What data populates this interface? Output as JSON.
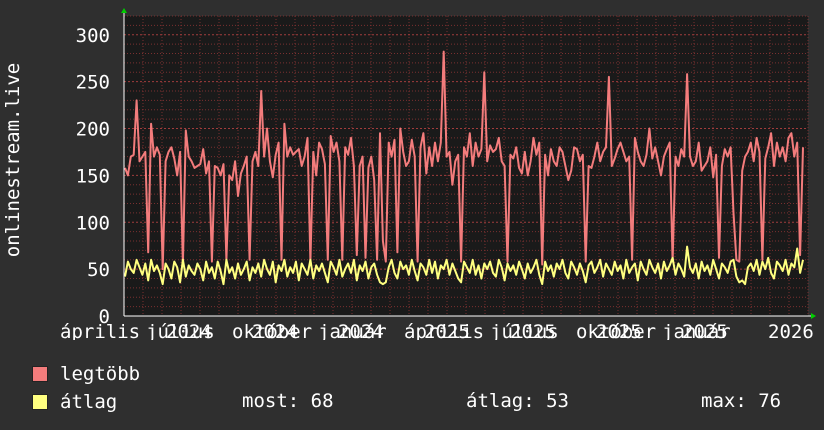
{
  "chart_data": {
    "type": "line",
    "ylabel": "onlinestream.live",
    "ylim": [
      0,
      320
    ],
    "yticks": [
      0,
      50,
      100,
      150,
      200,
      250,
      300
    ],
    "xticks": [
      {
        "label": "április",
        "t": 0.0
      },
      {
        "label": "2024",
        "t": 0.0
      },
      {
        "label": "július",
        "t": 0.125
      },
      {
        "label": "2024",
        "t": 0.125
      },
      {
        "label": "október",
        "t": 0.25
      },
      {
        "label": "2024",
        "t": 0.25
      },
      {
        "label": "január",
        "t": 0.375
      },
      {
        "label": "2025",
        "t": 0.375
      },
      {
        "label": "április",
        "t": 0.5
      },
      {
        "label": "2025",
        "t": 0.5
      },
      {
        "label": "július",
        "t": 0.625
      },
      {
        "label": "2025",
        "t": 0.625
      },
      {
        "label": "október",
        "t": 0.75
      },
      {
        "label": "2025",
        "t": 0.75
      },
      {
        "label": "január",
        "t": 0.875
      },
      {
        "label": "2026",
        "t": 0.875
      }
    ],
    "grid": true,
    "series": [
      {
        "name": "legtöbb",
        "color": "#f37c7c",
        "values": [
          158,
          150,
          170,
          172,
          230,
          165,
          170,
          175,
          68,
          205,
          170,
          180,
          172,
          50,
          165,
          175,
          180,
          168,
          150,
          175,
          55,
          198,
          170,
          165,
          158,
          160,
          162,
          178,
          152,
          165,
          58,
          160,
          158,
          150,
          162,
          60,
          150,
          145,
          165,
          128,
          152,
          160,
          170,
          60,
          165,
          175,
          160,
          240,
          170,
          200,
          165,
          148,
          172,
          185,
          60,
          205,
          170,
          180,
          172,
          175,
          178,
          160,
          170,
          190,
          58,
          175,
          150,
          185,
          178,
          162,
          60,
          192,
          175,
          185,
          165,
          60,
          180,
          172,
          190,
          160,
          65,
          160,
          170,
          62,
          158,
          170,
          145,
          60,
          195,
          80,
          58,
          185,
          170,
          188,
          68,
          200,
          175,
          160,
          165,
          188,
          170,
          58,
          180,
          195,
          152,
          180,
          160,
          185,
          165,
          185,
          282,
          170,
          175,
          140,
          165,
          172,
          58,
          180,
          170,
          195,
          160,
          185,
          170,
          178,
          260,
          165,
          182,
          175,
          178,
          190,
          165,
          160,
          58,
          172,
          168,
          180,
          158,
          152,
          175,
          150,
          165,
          190,
          172,
          185,
          55,
          172,
          150,
          178,
          165,
          160,
          180,
          175,
          160,
          145,
          155,
          180,
          178,
          165,
          172,
          58,
          160,
          158,
          170,
          185,
          165,
          175,
          180,
          255,
          160,
          168,
          178,
          185,
          175,
          165,
          170,
          60,
          190,
          175,
          165,
          160,
          172,
          200,
          168,
          180,
          165,
          150,
          170,
          178,
          185,
          58,
          170,
          160,
          178,
          170,
          258,
          170,
          160,
          165,
          185,
          155,
          160,
          165,
          180,
          148,
          172,
          62,
          160,
          178,
          170,
          180,
          110,
          60,
          58,
          155,
          170,
          175,
          185,
          165,
          190,
          175,
          60,
          168,
          180,
          195,
          160,
          185,
          170,
          180,
          165,
          190,
          195,
          170,
          185,
          65,
          180
        ]
      },
      {
        "name": "átlag",
        "color": "#ffff80",
        "values": [
          42,
          58,
          50,
          46,
          60,
          52,
          44,
          56,
          38,
          60,
          48,
          54,
          46,
          34,
          56,
          50,
          40,
          58,
          52,
          36,
          60,
          42,
          54,
          48,
          44,
          56,
          50,
          38,
          58,
          46,
          52,
          40,
          58,
          48,
          34,
          60,
          46,
          52,
          40,
          56,
          44,
          50,
          58,
          38,
          52,
          46,
          56,
          42,
          60,
          50,
          44,
          58,
          36,
          54,
          48,
          60,
          42,
          52,
          46,
          58,
          38,
          56,
          50,
          44,
          60,
          40,
          54,
          48,
          56,
          46,
          36,
          58,
          52,
          44,
          60,
          42,
          50,
          56,
          46,
          60,
          38,
          54,
          48,
          58,
          40,
          52,
          56,
          44,
          36,
          34,
          36,
          52,
          60,
          46,
          40,
          58,
          50,
          54,
          44,
          60,
          48,
          38,
          56,
          52,
          44,
          60,
          46,
          58,
          40,
          54,
          50,
          60,
          44,
          56,
          48,
          40,
          36,
          58,
          52,
          46,
          60,
          44,
          54,
          40,
          56,
          50,
          58,
          46,
          42,
          60,
          52,
          38,
          56,
          48,
          54,
          44,
          58,
          50,
          40,
          56,
          46,
          52,
          60,
          44,
          34,
          58,
          48,
          54,
          42,
          56,
          50,
          60,
          46,
          40,
          58,
          52,
          44,
          56,
          48,
          36,
          54,
          58,
          46,
          52,
          60,
          42,
          56,
          50,
          44,
          58,
          48,
          54,
          40,
          60,
          46,
          52,
          56,
          38,
          58,
          50,
          44,
          60,
          52,
          46,
          56,
          40,
          58,
          48,
          54,
          62,
          44,
          56,
          50,
          42,
          74,
          52,
          46,
          56,
          40,
          58,
          48,
          54,
          44,
          60,
          50,
          40,
          56,
          52,
          46,
          58,
          60,
          42,
          36,
          38,
          34,
          52,
          56,
          48,
          60,
          44,
          58,
          50,
          62,
          46,
          40,
          58,
          54,
          48,
          60,
          44,
          56,
          52,
          72,
          46,
          60
        ]
      }
    ]
  },
  "legend": [
    {
      "label": "legtöbb",
      "color": "#f37c7c"
    },
    {
      "label": "átlag",
      "color": "#ffff80"
    }
  ],
  "stats": {
    "most": "most: 68",
    "atlag": "átlag: 53",
    "max": "max: 76"
  },
  "colors": {
    "background": "#2f2f2f",
    "plot_bg": "#1a1a1a",
    "grid": "#7a3030",
    "axis": "#ffffff",
    "arrow": "#00cc00"
  }
}
